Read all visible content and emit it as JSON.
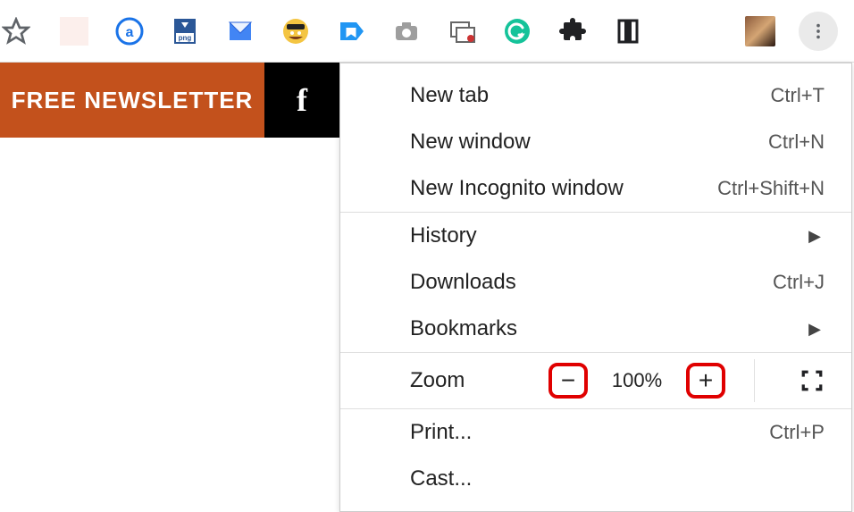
{
  "toolbar": {
    "icons": [
      {
        "name": "bookmark-star-icon"
      },
      {
        "name": "extension-blank-icon"
      },
      {
        "name": "extension-a-circle-icon"
      },
      {
        "name": "extension-png-download-icon"
      },
      {
        "name": "extension-inbox-icon"
      },
      {
        "name": "extension-face-icon"
      },
      {
        "name": "extension-tag-icon"
      },
      {
        "name": "extension-camera-icon"
      },
      {
        "name": "extension-screenshot-icon"
      },
      {
        "name": "extension-grammarly-icon"
      },
      {
        "name": "extensions-puzzle-icon"
      },
      {
        "name": "reading-list-icon"
      },
      {
        "name": "profile-avatar"
      },
      {
        "name": "kebab-menu-icon"
      }
    ]
  },
  "banner": {
    "text": "FREE NEWSLETTER",
    "social": "f"
  },
  "menu": {
    "new_tab": {
      "label": "New tab",
      "shortcut": "Ctrl+T"
    },
    "new_window": {
      "label": "New window",
      "shortcut": "Ctrl+N"
    },
    "new_incognito": {
      "label": "New Incognito window",
      "shortcut": "Ctrl+Shift+N"
    },
    "history": {
      "label": "History"
    },
    "downloads": {
      "label": "Downloads",
      "shortcut": "Ctrl+J"
    },
    "bookmarks": {
      "label": "Bookmarks"
    },
    "zoom": {
      "label": "Zoom",
      "minus": "−",
      "value": "100%",
      "plus": "+"
    },
    "print": {
      "label": "Print...",
      "shortcut": "Ctrl+P"
    },
    "cast": {
      "label": "Cast..."
    }
  }
}
